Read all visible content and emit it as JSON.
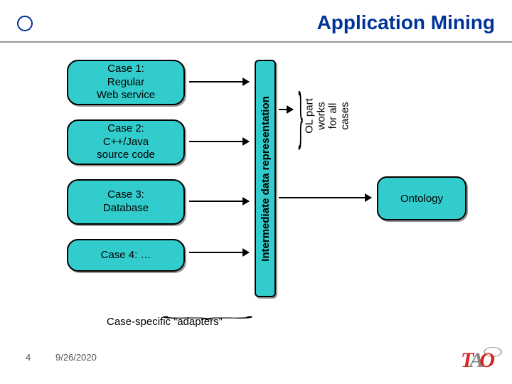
{
  "title": "Application Mining",
  "cases": [
    {
      "line1": "Case 1:",
      "line2": "Regular",
      "line3": "Web service"
    },
    {
      "line1": "Case 2:",
      "line2": "C++/Java",
      "line3": "source code"
    },
    {
      "line1": "Case 3:",
      "line2": "Database",
      "line3": ""
    },
    {
      "line1": "Case 4: …",
      "line2": "",
      "line3": ""
    }
  ],
  "intermediate_label": "Intermediate data representation",
  "ol_label": "OL part\nworks\nfor all\ncases",
  "ontology_label": "Ontology",
  "adapters_label": "Case-specific “adapters”",
  "slide_number": "4",
  "slide_date": "9/26/2020",
  "logo": {
    "t": "T",
    "a": "A",
    "o": "O"
  },
  "colors": {
    "accent": "#33cccc",
    "title": "#003399"
  }
}
